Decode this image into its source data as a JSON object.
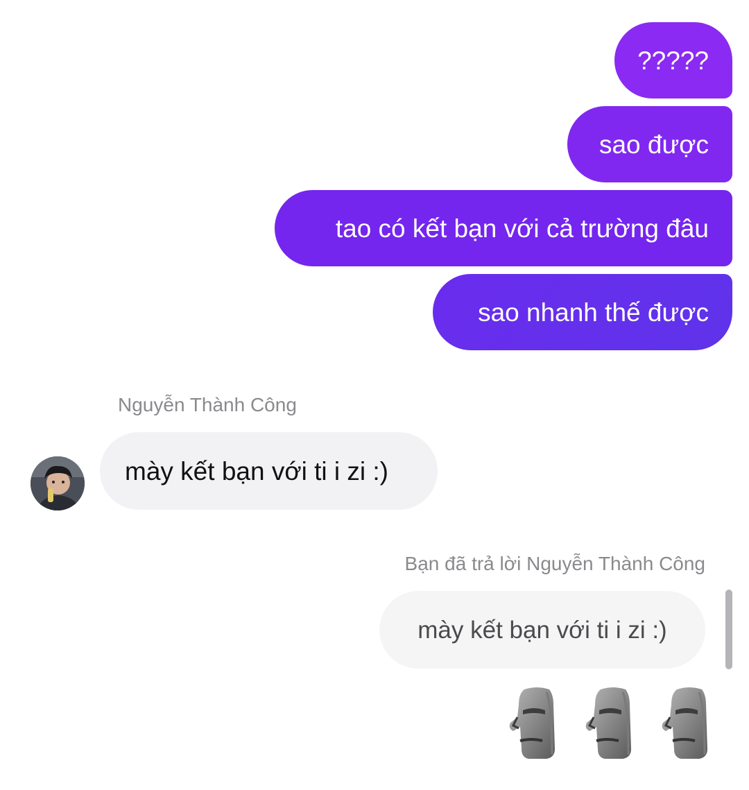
{
  "messages_out": [
    {
      "text": "?????"
    },
    {
      "text": "sao được"
    },
    {
      "text": "tao có kết bạn với cả trường đâu"
    },
    {
      "text": "sao nhanh thế được"
    }
  ],
  "incoming": {
    "sender_name": "Nguyễn Thành Công",
    "text": "mày kết bạn với ti i zi :)"
  },
  "reply": {
    "label": "Bạn đã trả lời Nguyễn Thành Công",
    "quoted_text": "mày kết bạn với ti i zi :)",
    "emoji": [
      "moai-icon",
      "moai-icon",
      "moai-icon"
    ]
  },
  "colors": {
    "outgoing_bubble_top": "#8a2af2",
    "outgoing_bubble_bottom": "#5f33ea",
    "incoming_bubble": "#f2f2f4",
    "meta_text": "#8a8a8e"
  }
}
